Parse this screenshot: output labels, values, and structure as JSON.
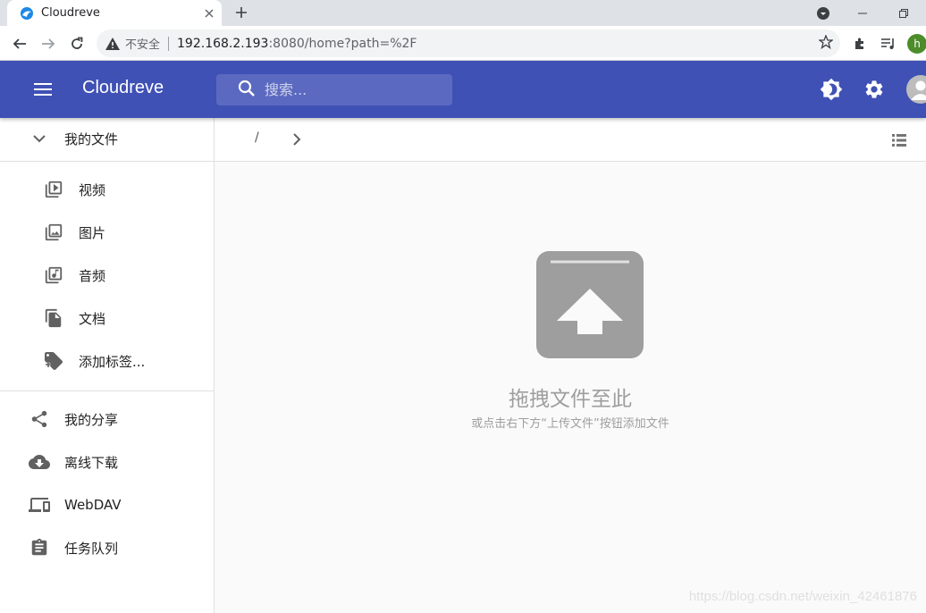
{
  "browser": {
    "tab_title": "Cloudreve",
    "insecure_label": "不安全",
    "url_host": "192.168.2.193",
    "url_path": ":8080/home?path=%2F",
    "profile_initial": "h"
  },
  "appbar": {
    "brand": "Cloudreve",
    "search_placeholder": "搜索...",
    "color": "#3f51b5"
  },
  "sidebar": {
    "my_files": "我的文件",
    "categories": [
      {
        "label": "视频",
        "icon": "video-library-icon"
      },
      {
        "label": "图片",
        "icon": "photo-library-icon"
      },
      {
        "label": "音频",
        "icon": "music-library-icon"
      },
      {
        "label": "文档",
        "icon": "file-copy-icon"
      },
      {
        "label": "添加标签...",
        "icon": "add-tag-icon"
      }
    ],
    "items": [
      {
        "label": "我的分享",
        "icon": "share-icon"
      },
      {
        "label": "离线下载",
        "icon": "cloud-download-icon"
      },
      {
        "label": "WebDAV",
        "icon": "devices-icon"
      },
      {
        "label": "任务队列",
        "icon": "assignment-icon"
      }
    ]
  },
  "navigator": {
    "root_separator": "/"
  },
  "empty_state": {
    "title": "拖拽文件至此",
    "subtitle": "或点击右下方“上传文件”按钮添加文件"
  },
  "watermark": "https://blog.csdn.net/weixin_42461876"
}
